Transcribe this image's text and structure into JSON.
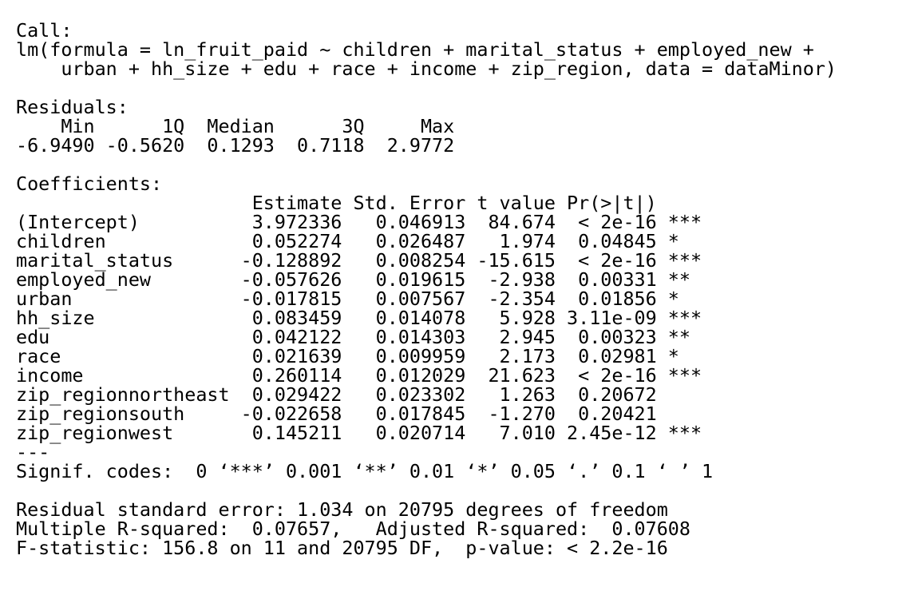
{
  "call": {
    "header": "Call:",
    "line1": "lm(formula = ln_fruit_paid ~ children + marital_status + employed_new +",
    "line2": "    urban + hh_size + edu + race + income + zip_region, data = dataMinor)"
  },
  "residuals": {
    "header": "Residuals:",
    "labels": "    Min      1Q  Median      3Q     Max ",
    "values": "-6.9490 -0.5620  0.1293  0.7118  2.9772 "
  },
  "coefficients": {
    "header": "Coefficients:",
    "columns": "                     Estimate Std. Error t value Pr(>|t|)    ",
    "rows": [
      "(Intercept)          3.972336   0.046913  84.674  < 2e-16 ***",
      "children             0.052274   0.026487   1.974  0.04845 *  ",
      "marital_status      -0.128892   0.008254 -15.615  < 2e-16 ***",
      "employed_new        -0.057626   0.019615  -2.938  0.00331 ** ",
      "urban               -0.017815   0.007567  -2.354  0.01856 *  ",
      "hh_size              0.083459   0.014078   5.928 3.11e-09 ***",
      "edu                  0.042122   0.014303   2.945  0.00323 ** ",
      "race                 0.021639   0.009959   2.173  0.02981 *  ",
      "income               0.260114   0.012029  21.623  < 2e-16 ***",
      "zip_regionnortheast  0.029422   0.023302   1.263  0.20672    ",
      "zip_regionsouth     -0.022658   0.017845  -1.270  0.20421    ",
      "zip_regionwest       0.145211   0.020714   7.010 2.45e-12 ***"
    ],
    "separator": "---",
    "signif": "Signif. codes:  0 ‘***’ 0.001 ‘**’ 0.01 ‘*’ 0.05 ‘.’ 0.1 ‘ ’ 1"
  },
  "fit": {
    "rse": "Residual standard error: 1.034 on 20795 degrees of freedom",
    "rsq": "Multiple R-squared:  0.07657,\tAdjusted R-squared:  0.07608 ",
    "fstat": "F-statistic: 156.8 on 11 and 20795 DF,  p-value: < 2.2e-16"
  }
}
